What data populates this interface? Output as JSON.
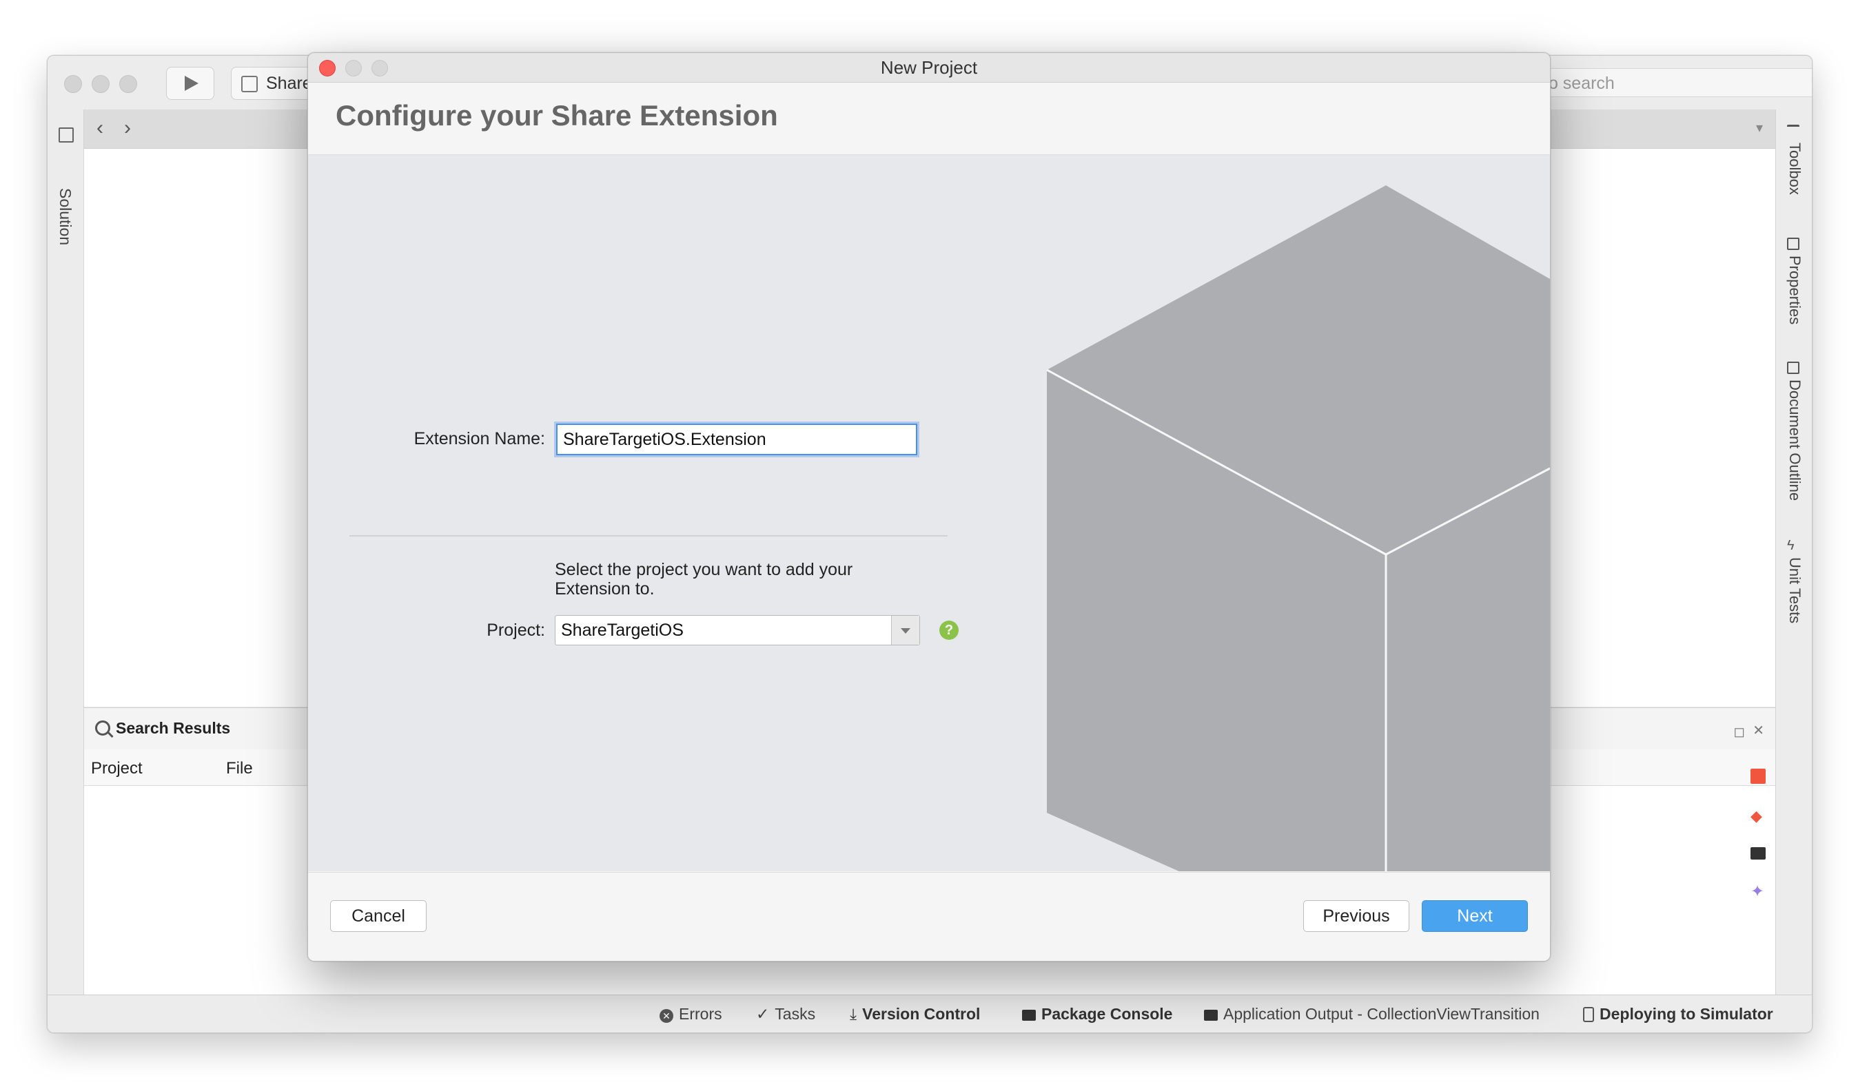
{
  "ide": {
    "scheme_label": "Share",
    "search_placeholder": "to search",
    "left_pad_label": "Solution",
    "right_pads": [
      "Toolbox",
      "Properties",
      "Document Outline",
      "Unit Tests"
    ],
    "search_pad": {
      "title": "Search Results",
      "columns": [
        "Project",
        "File"
      ]
    },
    "status_bar": {
      "errors": "Errors",
      "tasks": "Tasks",
      "version_control": "Version Control",
      "package_console": "Package Console",
      "application_output": "Application Output - CollectionViewTransition",
      "deploying": "Deploying to Simulator"
    }
  },
  "dialog": {
    "window_title": "New Project",
    "heading": "Configure your Share Extension",
    "extension_name_label": "Extension Name:",
    "extension_name_value": "ShareTargetiOS.Extension",
    "project_help_text": "Select the project you want to add your Extension to.",
    "project_label": "Project:",
    "project_value": "ShareTargetiOS",
    "help_glyph": "?",
    "buttons": {
      "cancel": "Cancel",
      "previous": "Previous",
      "next": "Next"
    }
  },
  "colors": {
    "accent": "#4aa3ee",
    "close_red": "#fc5f57",
    "help_green": "#8bc34a",
    "cube_gray": "#adaeb1"
  }
}
